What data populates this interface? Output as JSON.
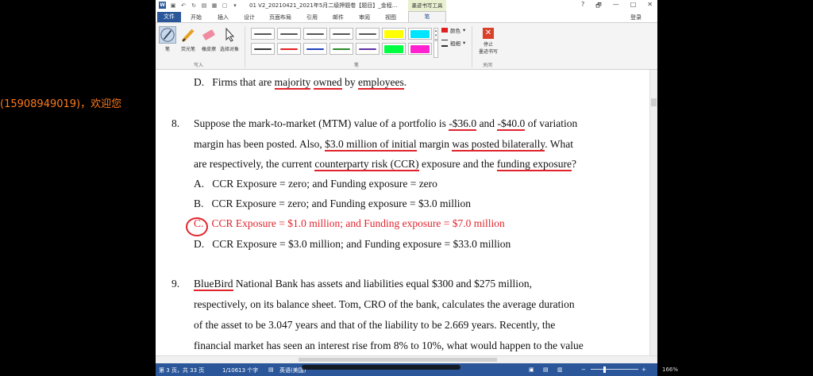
{
  "watermark": "(15908949019)，欢迎您",
  "titlebar": {
    "app_icon": "W",
    "document_title": "01 V2_20210421_2021年5月二级押题卷【题目】_金程...",
    "ink_tools_header": "墨迹书写工具",
    "help": "?",
    "restore": "🗗",
    "minimize": "—",
    "maximize": "□",
    "close": "✕"
  },
  "menu": {
    "file": "文件",
    "tabs": [
      "开始",
      "插入",
      "设计",
      "页面布局",
      "引用",
      "邮件",
      "审阅",
      "视图"
    ],
    "pen_tab": "笔",
    "login": "登录"
  },
  "ribbon": {
    "tools": [
      {
        "label": "笔",
        "icon": "pen-icon"
      },
      {
        "label": "荧光笔",
        "icon": "highlighter-icon"
      },
      {
        "label": "橡皮擦",
        "icon": "eraser-icon"
      },
      {
        "label": "选择对象",
        "icon": "select-object-icon"
      }
    ],
    "group_write": "写入",
    "group_pen": "笔",
    "group_close": "关闭",
    "color_label": "颜色",
    "thickness_label": "粗细",
    "stop_label_1": "停止",
    "stop_label_2": "墨迹书写",
    "pen_colors": [
      "#555555",
      "#555555",
      "#555555",
      "#555555",
      "#555555",
      "#ffff00",
      "#00e5ff",
      "#333333",
      "#e02020",
      "#2040c0",
      "#2a8a2a",
      "#6030a0",
      "#00ff40",
      "#ff20d0"
    ]
  },
  "doc": {
    "q7_option_d_label": "D.",
    "q7_option_d_pre": "Firms that are ",
    "q7_option_d_u1": "majority",
    "q7_option_d_mid1": " ",
    "q7_option_d_u2": "owned",
    "q7_option_d_mid2": " by ",
    "q7_option_d_u3": "employees",
    "q7_option_d_end": ".",
    "q8_num": "8.",
    "q8_l1_a": "Suppose the mark-to-market (MTM) value of a portfolio is ",
    "q8_l1_u1": "-$36.0",
    "q8_l1_b": " and ",
    "q8_l1_u2": "-$40.0",
    "q8_l1_c": " of variation",
    "q8_l2_a": "margin has been posted. Also, ",
    "q8_l2_u1": "$3.0 million of initial",
    "q8_l2_b": " margin ",
    "q8_l2_u2": "was posted bilaterally",
    "q8_l2_c": ". What",
    "q8_l3_a": "are respectively, the current ",
    "q8_l3_u1": "counterparty risk (CCR)",
    "q8_l3_b": " exposure and the ",
    "q8_l3_u2": "funding exposure",
    "q8_l3_c": "?",
    "q8_options": [
      {
        "label": "A.",
        "text": "CCR Exposure = zero; and Funding exposure = zero"
      },
      {
        "label": "B.",
        "text": "CCR Exposure = zero; and Funding exposure = $3.0 million"
      },
      {
        "label": "C.",
        "text": "CCR Exposure = $1.0 million; and Funding exposure = $7.0 million"
      },
      {
        "label": "D.",
        "text": "CCR Exposure = $3.0 million; and Funding exposure = $33.0 million"
      }
    ],
    "q9_num": "9.",
    "q9_l1_u": "BlueBird",
    "q9_l1_rest": " National Bank has assets and liabilities equal $300 and $275 million,",
    "q9_l2": "respectively, on its balance sheet. Tom, CRO of the bank, calculates the average duration",
    "q9_l3": "of the asset to be 3.047 years and that of the liability to be 2.669 years. Recently, the",
    "q9_l4": "financial market has seen an interest rise from 8% to 10%, what would happen to the value"
  },
  "status": {
    "page": "第 3 页，共 33 页",
    "words": "1/10613 个字",
    "language": "英语(美国)",
    "zoom": "166%",
    "zoom_minus": "−",
    "zoom_plus": "+"
  }
}
